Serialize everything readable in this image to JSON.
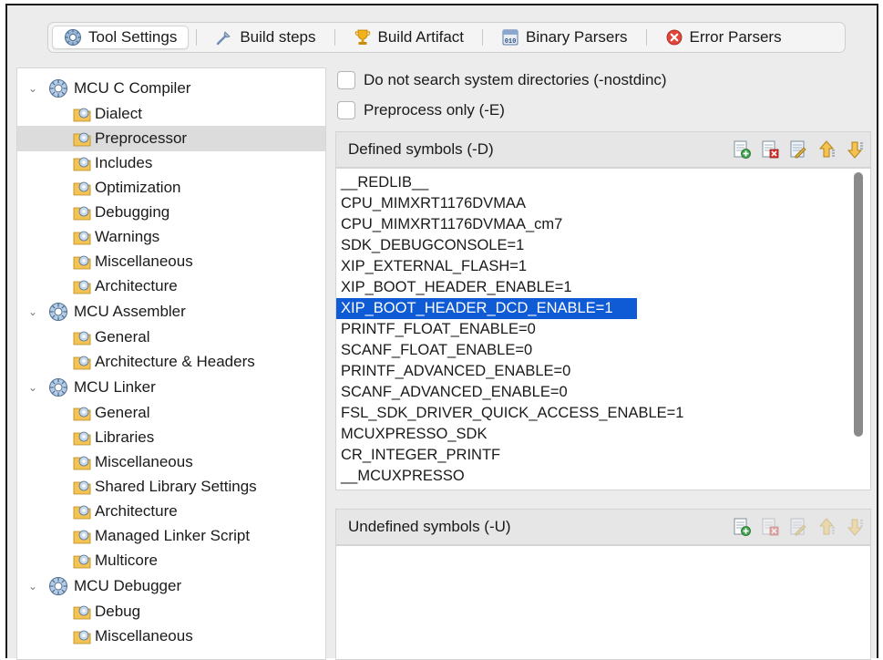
{
  "tabs": [
    {
      "label": "Tool Settings",
      "icon": "gear-icon",
      "active": true
    },
    {
      "label": "Build steps",
      "icon": "wrench-icon",
      "active": false
    },
    {
      "label": "Build Artifact",
      "icon": "trophy-icon",
      "active": false
    },
    {
      "label": "Binary Parsers",
      "icon": "binary-icon",
      "active": false
    },
    {
      "label": "Error Parsers",
      "icon": "error-icon",
      "active": false
    }
  ],
  "tree": {
    "groups": [
      {
        "label": "MCU C Compiler",
        "children": [
          "Dialect",
          "Preprocessor",
          "Includes",
          "Optimization",
          "Debugging",
          "Warnings",
          "Miscellaneous",
          "Architecture"
        ]
      },
      {
        "label": "MCU Assembler",
        "children": [
          "General",
          "Architecture & Headers"
        ]
      },
      {
        "label": "MCU Linker",
        "children": [
          "General",
          "Libraries",
          "Miscellaneous",
          "Shared Library Settings",
          "Architecture",
          "Managed Linker Script",
          "Multicore"
        ]
      },
      {
        "label": "MCU Debugger",
        "children": [
          "Debug",
          "Miscellaneous"
        ]
      }
    ],
    "selected": "Preprocessor"
  },
  "options": {
    "nostdinc_label": "Do not search system directories (-nostdinc)",
    "preprocess_only_label": "Preprocess only (-E)"
  },
  "defined": {
    "title": "Defined symbols (-D)",
    "symbols": [
      "__REDLIB__",
      "CPU_MIMXRT1176DVMAA",
      "CPU_MIMXRT1176DVMAA_cm7",
      "SDK_DEBUGCONSOLE=1",
      "XIP_EXTERNAL_FLASH=1",
      "XIP_BOOT_HEADER_ENABLE=1",
      "XIP_BOOT_HEADER_DCD_ENABLE=1",
      "PRINTF_FLOAT_ENABLE=0",
      "SCANF_FLOAT_ENABLE=0",
      "PRINTF_ADVANCED_ENABLE=0",
      "SCANF_ADVANCED_ENABLE=0",
      "FSL_SDK_DRIVER_QUICK_ACCESS_ENABLE=1",
      "MCUXPRESSO_SDK",
      "CR_INTEGER_PRINTF",
      "__MCUXPRESSO"
    ],
    "selected": "XIP_BOOT_HEADER_DCD_ENABLE=1"
  },
  "undefined": {
    "title": "Undefined symbols (-U)",
    "symbols": []
  },
  "toolbar_icons": [
    "add-icon",
    "delete-icon",
    "edit-icon",
    "move-up-icon",
    "move-down-icon"
  ],
  "colors": {
    "selection": "#0f5bd6",
    "tree_selection": "#dcdcdc"
  }
}
